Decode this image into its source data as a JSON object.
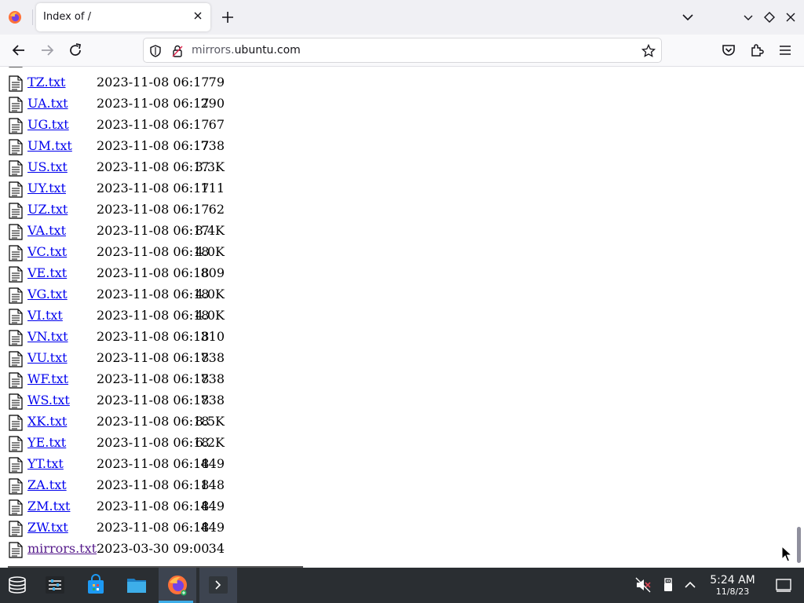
{
  "browser": {
    "tab_title": "Index of /",
    "url_prefix": "mirrors.",
    "url_host": "ubuntu.com"
  },
  "listing": {
    "rows": [
      {
        "name": "TZ.txt",
        "date": "2023-11-08 06:17",
        "size": "79"
      },
      {
        "name": "UA.txt",
        "date": "2023-11-08 06:17",
        "size": "290"
      },
      {
        "name": "UG.txt",
        "date": "2023-11-08 06:17",
        "size": "67"
      },
      {
        "name": "UM.txt",
        "date": "2023-11-08 06:17",
        "size": "738"
      },
      {
        "name": "US.txt",
        "date": "2023-11-08 06:17",
        "size": "3.3K"
      },
      {
        "name": "UY.txt",
        "date": "2023-11-08 06:17",
        "size": "111"
      },
      {
        "name": "UZ.txt",
        "date": "2023-11-08 06:17",
        "size": "62"
      },
      {
        "name": "VA.txt",
        "date": "2023-11-08 06:17",
        "size": "8.4K"
      },
      {
        "name": "VC.txt",
        "date": "2023-11-08 06:18",
        "size": "4.0K"
      },
      {
        "name": "VE.txt",
        "date": "2023-11-08 06:18",
        "size": "809"
      },
      {
        "name": "VG.txt",
        "date": "2023-11-08 06:18",
        "size": "4.0K"
      },
      {
        "name": "VI.txt",
        "date": "2023-11-08 06:18",
        "size": "4.0K"
      },
      {
        "name": "VN.txt",
        "date": "2023-11-08 06:18",
        "size": "310"
      },
      {
        "name": "VU.txt",
        "date": "2023-11-08 06:18",
        "size": "738"
      },
      {
        "name": "WF.txt",
        "date": "2023-11-08 06:18",
        "size": "738"
      },
      {
        "name": "WS.txt",
        "date": "2023-11-08 06:18",
        "size": "738"
      },
      {
        "name": "XK.txt",
        "date": "2023-11-08 06:18",
        "size": "8.5K"
      },
      {
        "name": "YE.txt",
        "date": "2023-11-08 06:18",
        "size": "6.2K"
      },
      {
        "name": "YT.txt",
        "date": "2023-11-08 06:18",
        "size": "449"
      },
      {
        "name": "ZA.txt",
        "date": "2023-11-08 06:18",
        "size": "148"
      },
      {
        "name": "ZM.txt",
        "date": "2023-11-08 06:18",
        "size": "449"
      },
      {
        "name": "ZW.txt",
        "date": "2023-11-08 06:18",
        "size": "449"
      },
      {
        "name": "mirrors.txt",
        "date": "2023-03-30 09:00",
        "size": "34",
        "visited": true
      }
    ]
  },
  "taskbar": {
    "time": "5:24 AM",
    "date": "11/8/23"
  },
  "colors": {
    "link": "#0000ee",
    "visited_link": "#551a8b",
    "taskbar_bg": "#2a2e32",
    "accent": "#3daee9"
  },
  "icons": {
    "tabstrip": [
      "firefox-icon",
      "close-icon",
      "plus-icon",
      "chevron-down-icon",
      "minimize-icon",
      "maximize-icon",
      "close-window-icon"
    ],
    "navbar": [
      "back-arrow-icon",
      "forward-arrow-icon",
      "reload-icon",
      "shield-icon",
      "lock-icon",
      "star-icon",
      "pocket-icon",
      "extensions-icon",
      "menu-icon"
    ],
    "taskbar": [
      "app-launcher-icon",
      "settings-icon",
      "store-icon",
      "file-manager-icon",
      "firefox-icon",
      "terminal-icon",
      "mute-icon",
      "usb-icon",
      "chevron-up-icon",
      "show-desktop-icon"
    ]
  }
}
